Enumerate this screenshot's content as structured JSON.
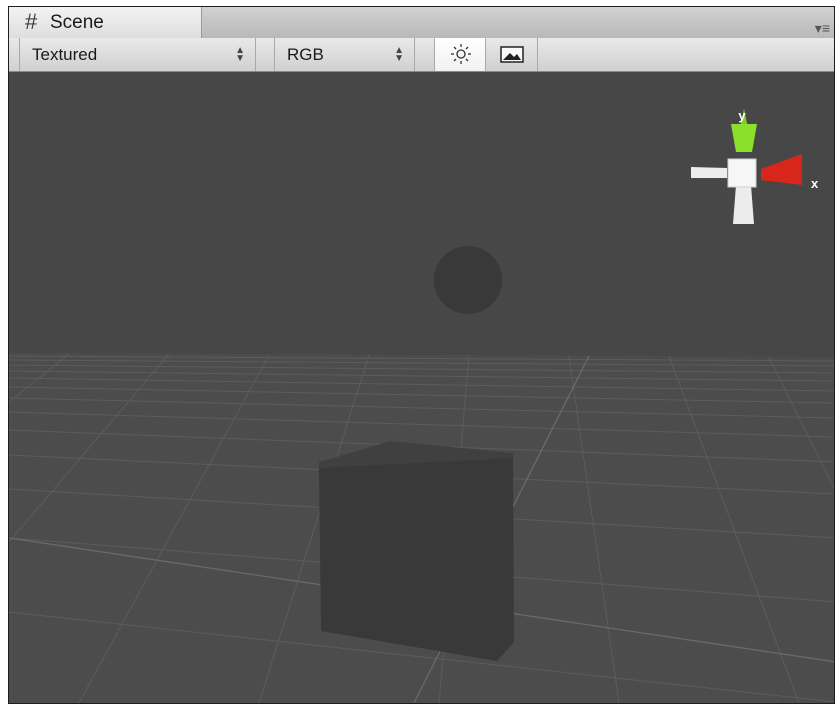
{
  "window": {
    "title": "Scene",
    "icon": "hash-grid-icon"
  },
  "tab_menu_icon": "panel-menu-icon",
  "toolbar": {
    "render_mode": "Textured",
    "color_channel": "RGB",
    "scene_lighting": "sun-icon",
    "scene_overlay": "image-icon",
    "lighting_on": true
  },
  "scene": {
    "objects": [
      "sphere",
      "cube"
    ],
    "grid": true
  },
  "gizmo": {
    "labels": {
      "y": "y",
      "x": "x"
    },
    "colors": {
      "y": "#7bd21c",
      "x": "#d8271a",
      "neutral": "#ececec"
    }
  },
  "colors": {
    "viewport_bg": "#474747",
    "ground": "#4c4c4c",
    "object": "#393939"
  }
}
